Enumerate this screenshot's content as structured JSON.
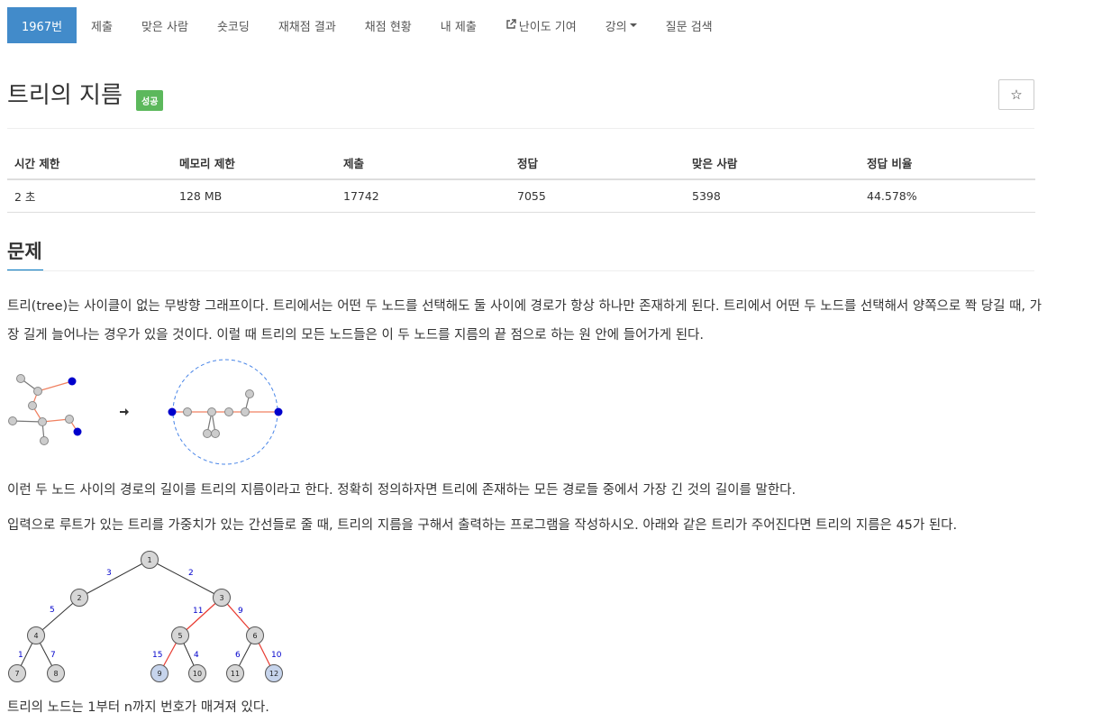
{
  "nav": {
    "items": [
      {
        "label": "1967번"
      },
      {
        "label": "제출"
      },
      {
        "label": "맞은 사람"
      },
      {
        "label": "숏코딩"
      },
      {
        "label": "재채점 결과"
      },
      {
        "label": "채점 현황"
      },
      {
        "label": "내 제출"
      },
      {
        "label": "난이도 기여"
      },
      {
        "label": "강의"
      },
      {
        "label": "질문 검색"
      }
    ]
  },
  "problem": {
    "title": "트리의 지름",
    "badge": "성공",
    "star_icon": "☆"
  },
  "info_table": {
    "headers": [
      "시간 제한",
      "메모리 제한",
      "제출",
      "정답",
      "맞은 사람",
      "정답 비율"
    ],
    "values": [
      "2 초",
      "128 MB",
      "17742",
      "7055",
      "5398",
      "44.578%"
    ]
  },
  "section": {
    "title": "문제"
  },
  "body": {
    "p1": "트리(tree)는 사이클이 없는 무방향 그래프이다. 트리에서는 어떤 두 노드를 선택해도 둘 사이에 경로가 항상 하나만 존재하게 된다. 트리에서 어떤 두 노드를 선택해서 양쪽으로 쫙 당길 때, 가장 길게 늘어나는 경우가 있을 것이다. 이럴 때 트리의 모든 노드들은 이 두 노드를 지름의 끝 점으로 하는 원 안에 들어가게 된다.",
    "p2": "이런 두 노드 사이의 경로의 길이를 트리의 지름이라고 한다. 정확히 정의하자면 트리에 존재하는 모든 경로들 중에서 가장 긴 것의 길이를 말한다.",
    "p3": "입력으로 루트가 있는 트리를 가중치가 있는 간선들로 줄 때, 트리의 지름을 구해서 출력하는 프로그램을 작성하시오. 아래와 같은 트리가 주어진다면 트리의 지름은 45가 된다.",
    "p4": "트리의 노드는 1부터 n까지 번호가 매겨져 있다."
  },
  "tree_figure": {
    "nodes": [
      "1",
      "2",
      "3",
      "4",
      "5",
      "6",
      "7",
      "8",
      "9",
      "10",
      "11",
      "12"
    ],
    "weights": [
      "3",
      "2",
      "5",
      "11",
      "9",
      "1",
      "7",
      "15",
      "4",
      "6",
      "10"
    ]
  },
  "colors": {
    "nav_active": "#428bca",
    "badge": "#5cb85c",
    "underline": "#0076c0",
    "diameter_edge": "#e8392f",
    "weight_text": "#0000cc"
  }
}
